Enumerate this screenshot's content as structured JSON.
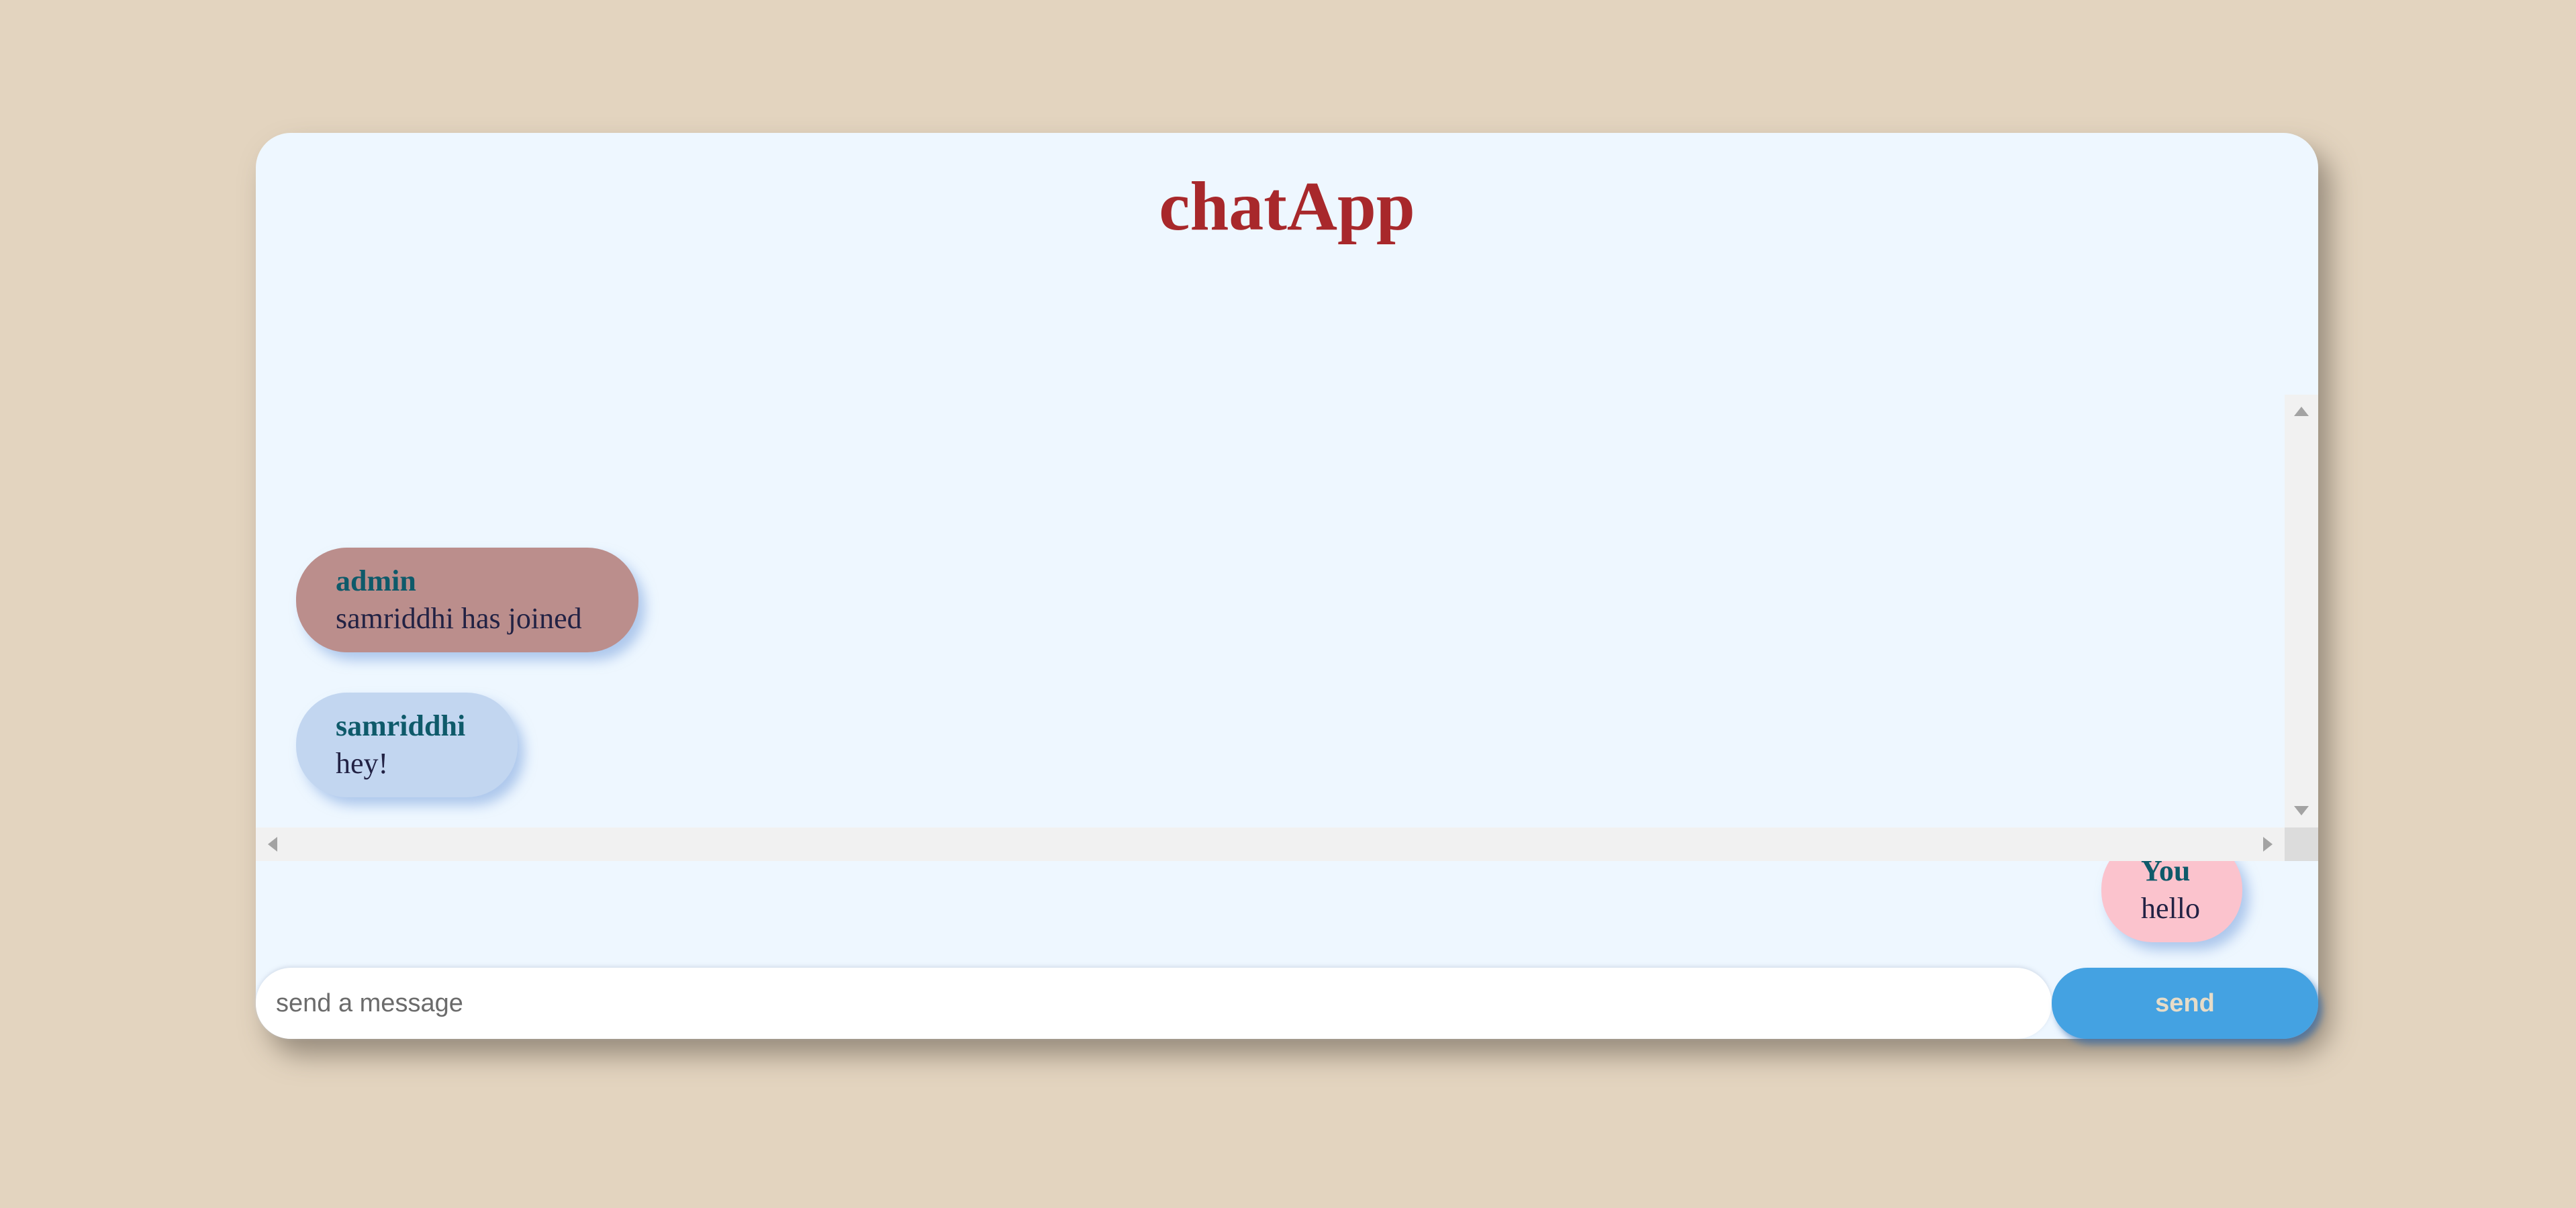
{
  "app": {
    "title": "chatApp"
  },
  "messages": [
    {
      "sender": "admin",
      "text": "samriddhi has joined",
      "color": "#bb8e8c",
      "align": "left"
    },
    {
      "sender": "samriddhi",
      "text": "hey!",
      "color": "#c2d6f0",
      "align": "left"
    },
    {
      "sender": "You",
      "text": "hello",
      "color": "#fbc3cd",
      "align": "right"
    }
  ],
  "composer": {
    "placeholder": "send a message",
    "value": "",
    "send_label": "send"
  },
  "colors": {
    "page_background": "#e3d4bf",
    "panel_background": "#eef7ff",
    "title": "#a8282b",
    "sender_name": "#0e5a6a",
    "send_button": "#44a2e2"
  }
}
